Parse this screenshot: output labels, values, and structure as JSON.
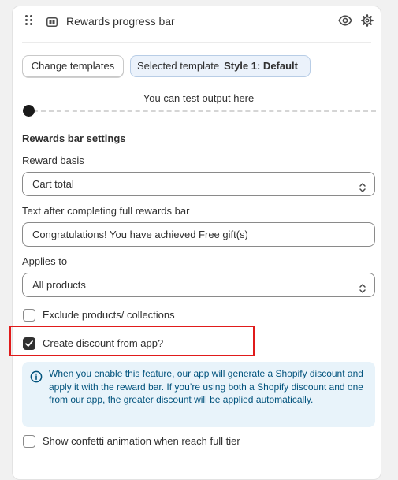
{
  "block": {
    "title": "Rewards progress bar"
  },
  "templates": {
    "change_label": "Change templates",
    "selected_prefix": "Selected template",
    "selected_value": "Style 1: Default"
  },
  "preview": {
    "test_label": "You can test output here",
    "slider_value": 0
  },
  "settings": {
    "section_title": "Rewards bar settings",
    "reward_basis_label": "Reward basis",
    "reward_basis_value": "Cart total",
    "completion_text_label": "Text after completing full rewards bar",
    "completion_text_value": "Congratulations! You have achieved Free gift(s)",
    "applies_to_label": "Applies to",
    "applies_to_value": "All products",
    "exclude_label": "Exclude products/ collections",
    "exclude_checked": false,
    "discount_label": "Create discount from app?",
    "discount_checked": true,
    "info_text": "When you enable this feature, our app will generate a Shopify discount and apply it with the reward bar. If you’re using both a Shopify discount and one from our app, the greater discount will be applied automatically.",
    "confetti_label": "Show confetti animation when reach full tier",
    "confetti_checked": false
  },
  "colors": {
    "highlight": "#e01b1b",
    "info_bg": "#e8f3fa",
    "info_text": "#00527c",
    "selected_bg": "#ebf2fb"
  },
  "icons": [
    "drag-handle-icon",
    "block-icon",
    "eye-icon",
    "gear-icon",
    "select-arrows-icon",
    "checkmark-icon",
    "info-icon"
  ]
}
